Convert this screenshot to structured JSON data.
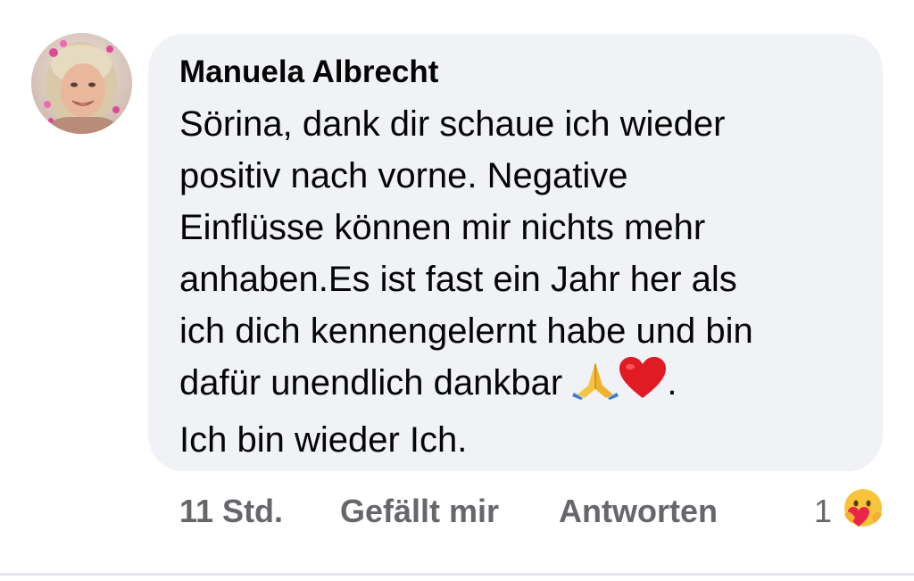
{
  "comment": {
    "author": "Manuela Albrecht",
    "lines": [
      "Sörina, dank dir schaue ich wieder",
      "positiv nach vorne. Negative",
      "Einflüsse können mir nichts mehr",
      "anhaben.Es ist fast ein Jahr her als",
      "ich dich kennengelernt habe und bin",
      "dafür unendlich dankbar",
      "Ich bin wieder Ich."
    ],
    "line_6_end": ".",
    "emojis": [
      "folded-hands-icon",
      "red-heart-icon"
    ]
  },
  "actions": {
    "timestamp": "11 Std.",
    "like_label": "Gefällt mir",
    "reply_label": "Antworten",
    "reaction_count": "1",
    "reaction_icon": "care-reaction-icon"
  },
  "colors": {
    "bubble": "#f0f2f5",
    "text": "#050505",
    "secondary_text": "#65676b"
  }
}
